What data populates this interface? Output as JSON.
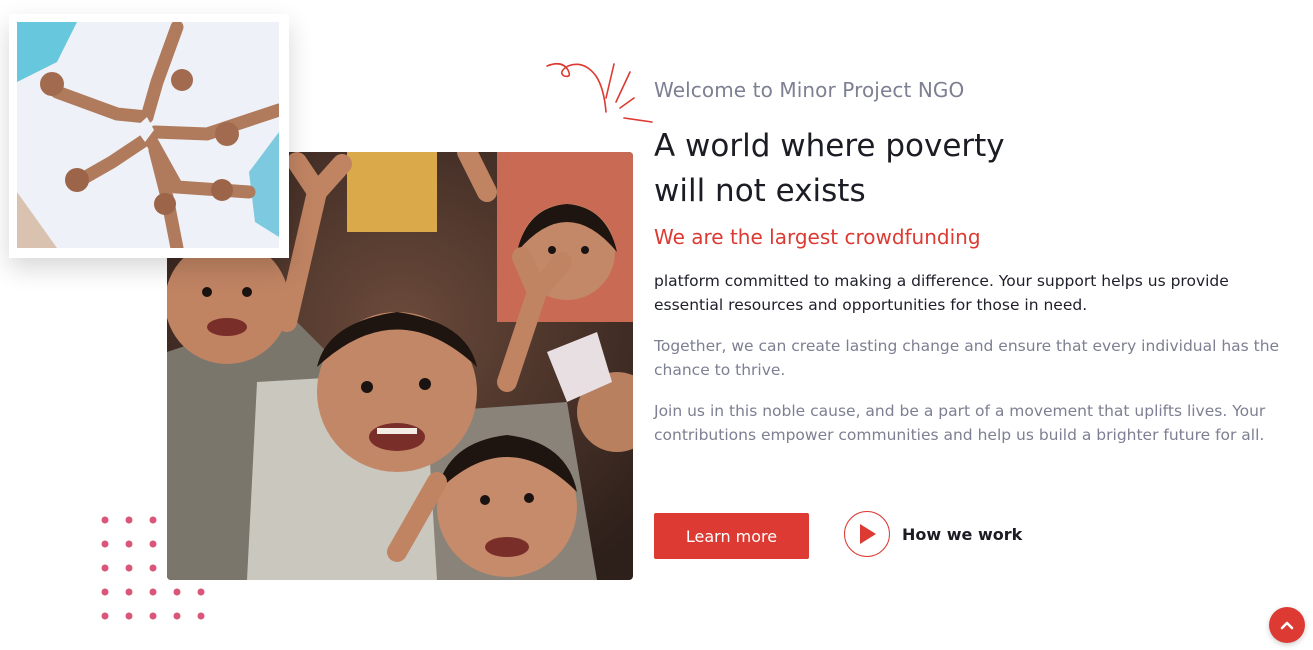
{
  "images": {
    "small_photo": "hands-star-photo",
    "large_photo": "smiling-children-photo"
  },
  "intro": {
    "eyebrow": "Welcome to Minor Project NGO",
    "headline_before": "A world where ",
    "headline_highlight": "poverty",
    "headline_after": "will not exists",
    "subheading": "We are the largest crowdfunding",
    "paragraph_1": "platform committed to making a difference. Your support helps us provide essential resources and opportunities for those in need.",
    "paragraph_2": "Together, we can create lasting change and ensure that every individual has the chance to thrive.",
    "paragraph_3": "Join us in this noble cause, and be a part of a movement that uplifts lives. Your contributions empower communities and help us build a brighter future for all."
  },
  "actions": {
    "learn_more_label": "Learn more",
    "how_we_work_label": "How we work"
  },
  "icons": {
    "play": "play-icon",
    "scroll_top": "chevron-up-icon",
    "decoration": "squiggle-icon"
  },
  "colors": {
    "accent": "#dc3a32",
    "highlight": "#f7c31b",
    "muted_text": "#7d7f92",
    "dots": "#d9557a"
  }
}
